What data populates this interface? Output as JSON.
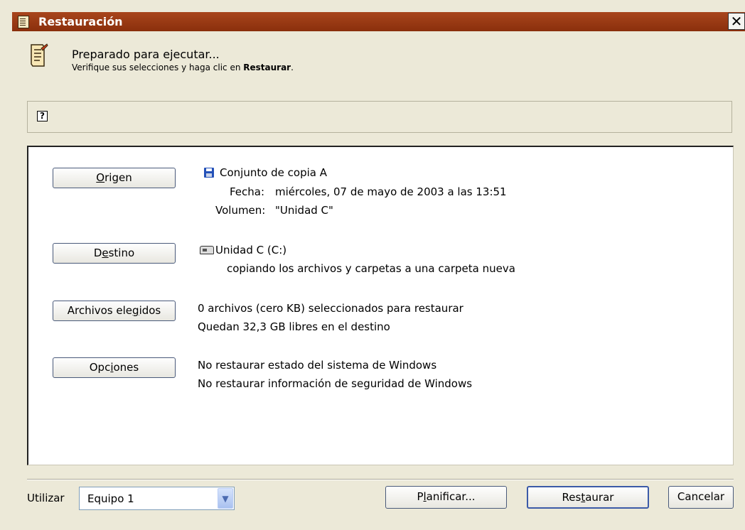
{
  "window": {
    "title": "Restauración",
    "close_glyph": "✕"
  },
  "header": {
    "line1": "Preparado para ejecutar...",
    "line2_prefix": "Verifique sus selecciones y haga clic en ",
    "line2_bold": "Restaurar",
    "line2_suffix": "."
  },
  "help": {
    "glyph": "?"
  },
  "sections": {
    "origen": {
      "button_pre": "",
      "button_ul": "O",
      "button_post": "rigen",
      "line1": "Conjunto de copia A",
      "fecha_label": "Fecha:",
      "fecha_value": "miércoles, 07 de mayo de 2003 a las 13:51",
      "volumen_label": "Volumen:",
      "volumen_value": "\"Unidad C\""
    },
    "destino": {
      "button_pre": "D",
      "button_ul": "e",
      "button_post": "stino",
      "line1": "Unidad C (C:)",
      "line2": "copiando los archivos y carpetas a una carpeta nueva"
    },
    "archivos": {
      "button_pre": "Archivos ele",
      "button_ul": "g",
      "button_post": "idos",
      "line1": "0 archivos (cero KB) seleccionados para restaurar",
      "line2": "Quedan 32,3 GB libres en el destino"
    },
    "opciones": {
      "button_pre": "Opc",
      "button_ul": "i",
      "button_post": "ones",
      "line1": "No restaurar estado del sistema de Windows",
      "line2": "No restaurar información de seguridad de Windows"
    }
  },
  "footer": {
    "utilizar_label": "Utilizar",
    "equipo_value": "Equipo 1",
    "planificar_pre": "P",
    "planificar_ul": "l",
    "planificar_post": "anificar...",
    "restaurar_pre": "Res",
    "restaurar_ul": "t",
    "restaurar_post": "aurar",
    "cancelar": "Cancelar"
  },
  "icons": [
    "notepad-icon",
    "help-icon",
    "floppy-disk-icon",
    "drive-icon",
    "dropdown-arrow-icon"
  ]
}
